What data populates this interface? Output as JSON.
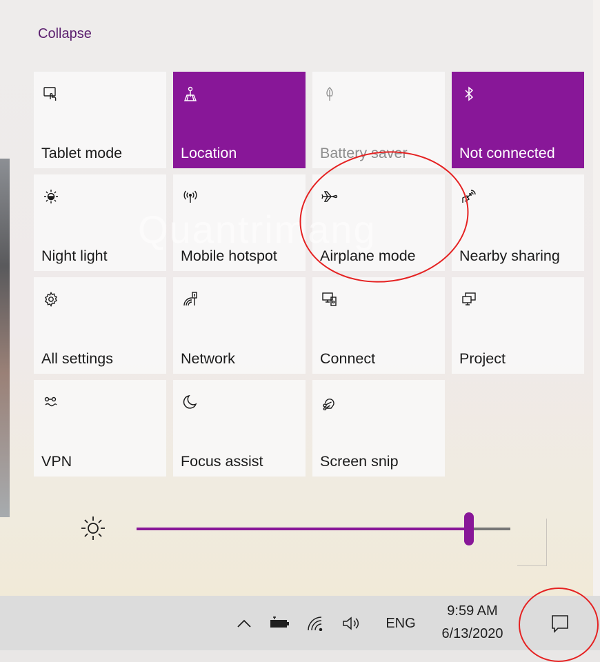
{
  "header": {
    "collapse_label": "Collapse"
  },
  "tiles": [
    {
      "label": "Tablet mode",
      "icon": "tablet-mode-icon",
      "state": "off"
    },
    {
      "label": "Location",
      "icon": "location-icon",
      "state": "on"
    },
    {
      "label": "Battery saver",
      "icon": "battery-saver-icon",
      "state": "disabled"
    },
    {
      "label": "Not connected",
      "icon": "bluetooth-icon",
      "state": "on"
    },
    {
      "label": "Night light",
      "icon": "night-light-icon",
      "state": "off"
    },
    {
      "label": "Mobile hotspot",
      "icon": "mobile-hotspot-icon",
      "state": "off"
    },
    {
      "label": "Airplane mode",
      "icon": "airplane-icon",
      "state": "off"
    },
    {
      "label": "Nearby sharing",
      "icon": "nearby-sharing-icon",
      "state": "off"
    },
    {
      "label": "All settings",
      "icon": "gear-icon",
      "state": "off"
    },
    {
      "label": "Network",
      "icon": "network-icon",
      "state": "off"
    },
    {
      "label": "Connect",
      "icon": "connect-icon",
      "state": "off"
    },
    {
      "label": "Project",
      "icon": "project-icon",
      "state": "off"
    },
    {
      "label": "VPN",
      "icon": "vpn-icon",
      "state": "off"
    },
    {
      "label": "Focus assist",
      "icon": "moon-icon",
      "state": "off"
    },
    {
      "label": "Screen snip",
      "icon": "screen-snip-icon",
      "state": "off"
    }
  ],
  "brightness": {
    "icon": "brightness-icon",
    "level": 0.89
  },
  "watermark": "Quantrimang",
  "taskbar": {
    "language": "ENG",
    "time": "9:59 AM",
    "date": "6/13/2020",
    "icons": [
      "chevron-up-icon",
      "battery-icon",
      "wifi-icon",
      "volume-icon",
      "action-center-icon"
    ]
  },
  "colors": {
    "accent": "#881798",
    "annotation": "#e52222"
  }
}
